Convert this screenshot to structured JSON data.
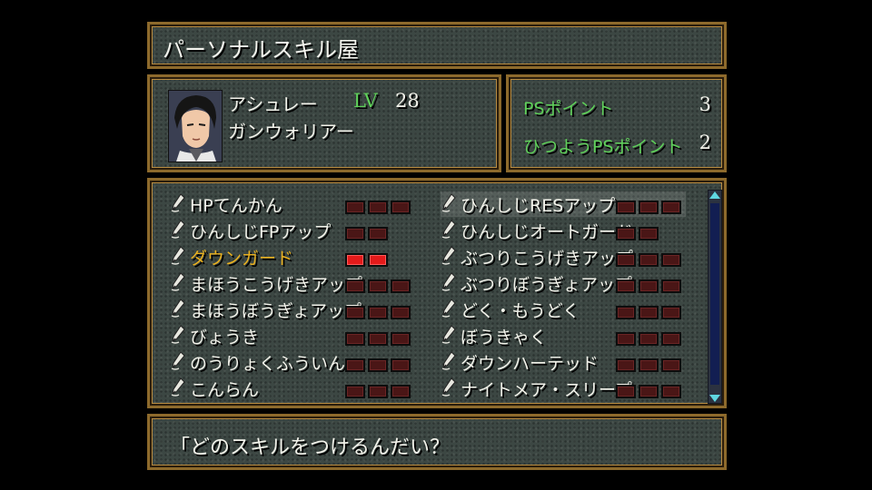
{
  "title": "パーソナルスキル屋",
  "character": {
    "name": "アシュレー",
    "class": "ガンウォリアー",
    "lv_label": "LV",
    "lv_value": "28"
  },
  "points": {
    "ps_label": "PSポイント",
    "ps_value": "3",
    "required_label": "ひつようPSポイント",
    "required_value": "2"
  },
  "skills_left": [
    {
      "name": "HPてんかん",
      "cost": 3,
      "lit": 0
    },
    {
      "name": "ひんしじFPアップ",
      "cost": 2,
      "lit": 0
    },
    {
      "name": "ダウンガード",
      "cost": 2,
      "lit": 2
    },
    {
      "name": "まほうこうげきアップ",
      "cost": 3,
      "lit": 0
    },
    {
      "name": "まほうぼうぎょアップ",
      "cost": 3,
      "lit": 0
    },
    {
      "name": "びょうき",
      "cost": 3,
      "lit": 0
    },
    {
      "name": "のうりょくふういん",
      "cost": 3,
      "lit": 0
    },
    {
      "name": "こんらん",
      "cost": 3,
      "lit": 0
    }
  ],
  "skills_right": [
    {
      "name": "ひんしじRESアップ",
      "cost": 3,
      "lit": 0
    },
    {
      "name": "ひんしじオートガード",
      "cost": 2,
      "lit": 0
    },
    {
      "name": "ぶつりこうげきアップ",
      "cost": 3,
      "lit": 0
    },
    {
      "name": "ぶつりぼうぎょアップ",
      "cost": 3,
      "lit": 0
    },
    {
      "name": "どく・もうどく",
      "cost": 3,
      "lit": 0
    },
    {
      "name": "ぼうきゃく",
      "cost": 3,
      "lit": 0
    },
    {
      "name": "ダウンハーテッド",
      "cost": 3,
      "lit": 0
    },
    {
      "name": "ナイトメア・スリープ",
      "cost": 3,
      "lit": 0
    }
  ],
  "highlighted_skill": "ダウンガード",
  "selected_skill": "ひんしじRESアップ",
  "message": "「どのスキルをつけるんだい？",
  "colors": {
    "frame": "#8d6a2c",
    "panel": "#3c4743",
    "label_green": "#5fd05a",
    "highlight_yellow": "#e8b020",
    "slot_active": "#e41a1a",
    "slot_inactive": "#4a1616"
  },
  "icons": {
    "skill": "pen-icon",
    "scroll_up": "triangle-up-icon",
    "scroll_down": "triangle-down-icon"
  }
}
